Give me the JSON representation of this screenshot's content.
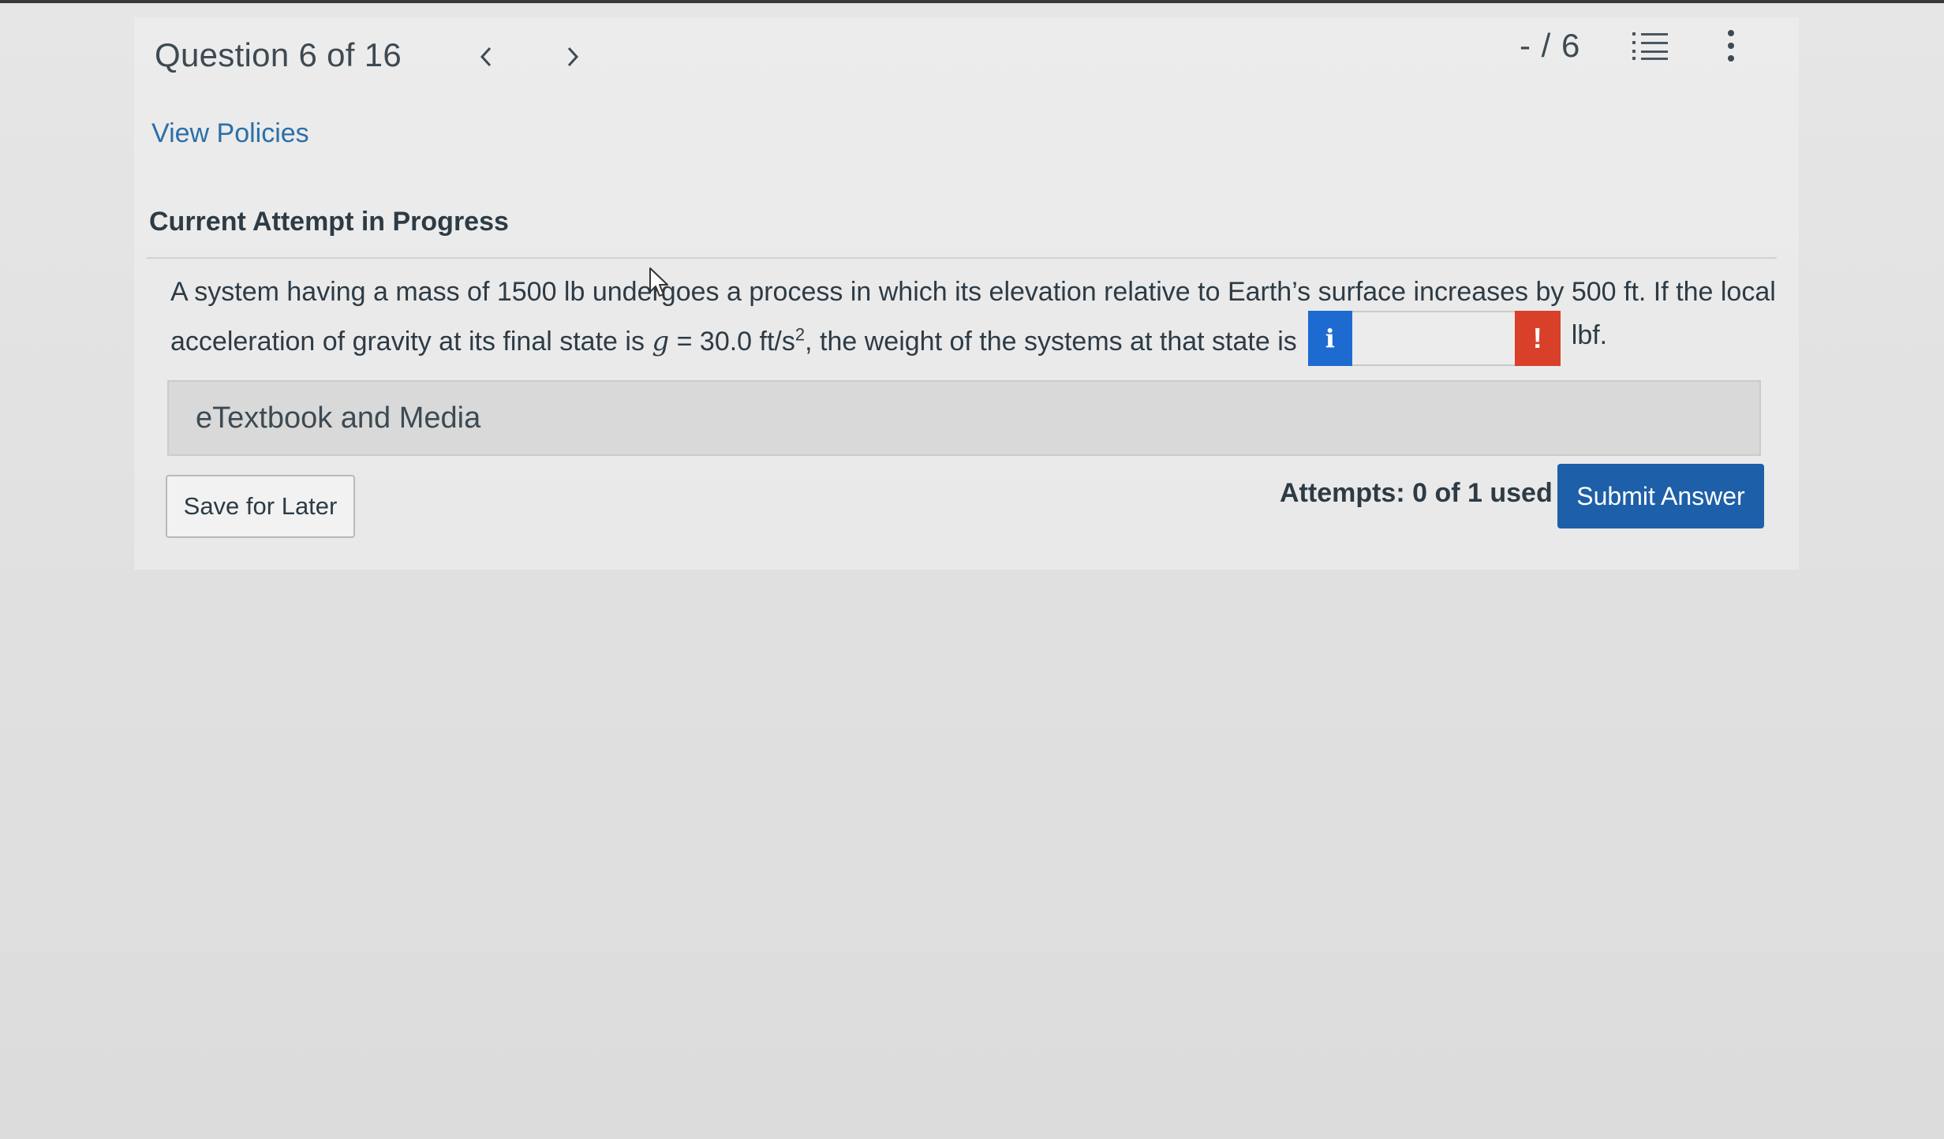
{
  "header": {
    "question_counter": "Question 6 of 16",
    "score": "- / 6"
  },
  "icons": {
    "prev": "chevron-left-icon",
    "next": "chevron-right-icon",
    "list": "numbered-list-icon",
    "menu": "kebab-menu-icon",
    "info": "info-icon",
    "error": "exclamation-icon",
    "cursor": "mouse-pointer-icon"
  },
  "links": {
    "view_policies": "View Policies"
  },
  "attempt": {
    "heading": "Current Attempt in Progress"
  },
  "question": {
    "line1": "A system having a mass of 1500 lb undergoes a process in which its elevation relative to Earth’s surface increases by 500 ft. If the local",
    "line2_prefix": "acceleration of gravity at its final state is ",
    "var_g": "g",
    "equals": " = ",
    "value": "30.0 ft/s",
    "exponent": "2",
    "line2_suffix": ", the weight of the systems at that state is",
    "info_glyph": "i",
    "answer_value": "",
    "error_glyph": "!",
    "unit": "lbf."
  },
  "etextbook": {
    "label": "eTextbook and Media"
  },
  "footer": {
    "save_label": "Save for Later",
    "attempts_text": "Attempts: 0 of 1 used",
    "submit_label": "Submit Answer"
  },
  "colors": {
    "link": "#2b6fa8",
    "info_button": "#1d6bd1",
    "error_button": "#d8402a",
    "submit_button": "#1d5fa8"
  }
}
